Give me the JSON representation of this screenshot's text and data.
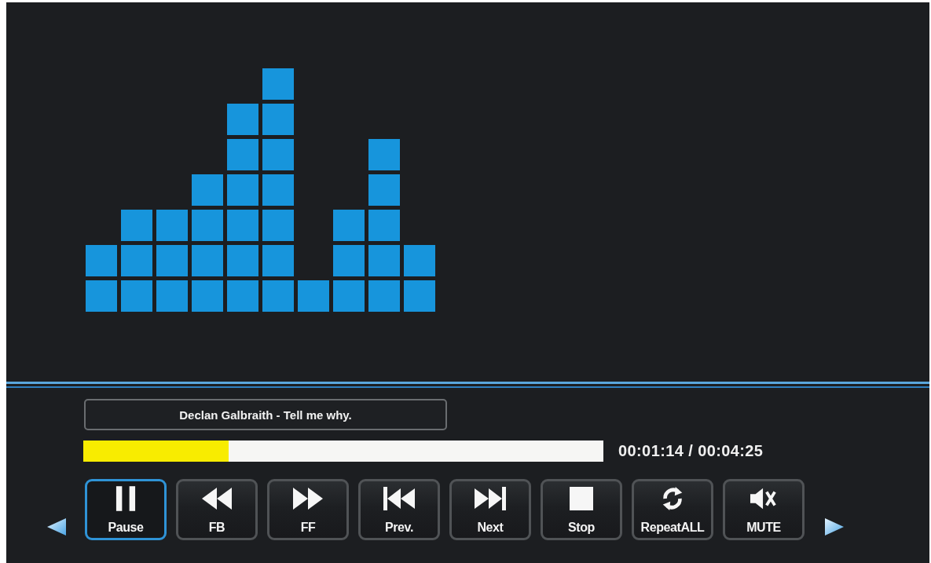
{
  "track": {
    "title": "Declan Galbraith - Tell me why."
  },
  "progress": {
    "level": 0.28,
    "time": "00:01:14 / 00:04:25"
  },
  "controls": [
    {
      "kind": "pause",
      "label": "Pause",
      "selected": true
    },
    {
      "kind": "rewind",
      "label": "FB",
      "selected": false
    },
    {
      "kind": "forward",
      "label": "FF",
      "selected": false
    },
    {
      "kind": "previous",
      "label": "Prev.",
      "selected": false
    },
    {
      "kind": "next",
      "label": "Next",
      "selected": false
    },
    {
      "kind": "stop",
      "label": "Stop",
      "selected": false
    },
    {
      "kind": "repeat",
      "label": "RepeatALL",
      "selected": false
    },
    {
      "kind": "mute",
      "label": "MUTE",
      "selected": false
    }
  ]
}
